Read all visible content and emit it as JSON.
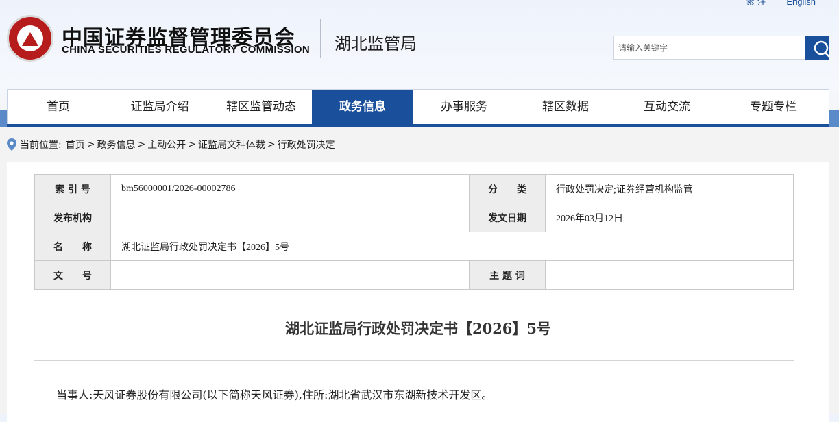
{
  "topbar": {
    "home": "紧 注",
    "english": "English"
  },
  "header": {
    "org_cn": "中国证券监督管理委员会",
    "org_en": "CHINA SECURITIES REGULATORY COMMISSION",
    "bureau": "湖北监管局"
  },
  "search": {
    "placeholder": "请输入关键字"
  },
  "nav": {
    "items": [
      {
        "label": "首页"
      },
      {
        "label": "证监局介绍"
      },
      {
        "label": "辖区监管动态"
      },
      {
        "label": "政务信息"
      },
      {
        "label": "办事服务"
      },
      {
        "label": "辖区数据"
      },
      {
        "label": "互动交流"
      },
      {
        "label": "专题专栏"
      }
    ],
    "active": "政务信息"
  },
  "breadcrumb": {
    "prefix": "当前位置:",
    "items": [
      "首页",
      "政务信息",
      "主动公开",
      "证监局文种体裁",
      "行政处罚决定"
    ],
    "separator": ">"
  },
  "meta": {
    "index_label": "索 引 号",
    "index_value": "bm56000001/2026-00002786",
    "category_label": "分　　类",
    "category_value": "行政处罚决定;证券经营机构监管",
    "issuer_label": "发布机构",
    "issuer_value": "",
    "date_label": "发文日期",
    "date_value": "2026年03月12日",
    "name_label": "名　　称",
    "name_value": "湖北证监局行政处罚决定书【2026】5号",
    "docno_label": "文　　号",
    "docno_value": "",
    "keywords_label": "主 题 词",
    "keywords_value": ""
  },
  "document": {
    "title": "湖北证监局行政处罚决定书【2026】5号",
    "party": "当事人:天风证券股份有限公司(以下简称天风证券),住所:湖北省武汉市东湖新技术开发区。"
  },
  "colors": {
    "primary": "#1a4f9c",
    "label_bg": "#ededed",
    "logo_red": "#b71c1c"
  }
}
